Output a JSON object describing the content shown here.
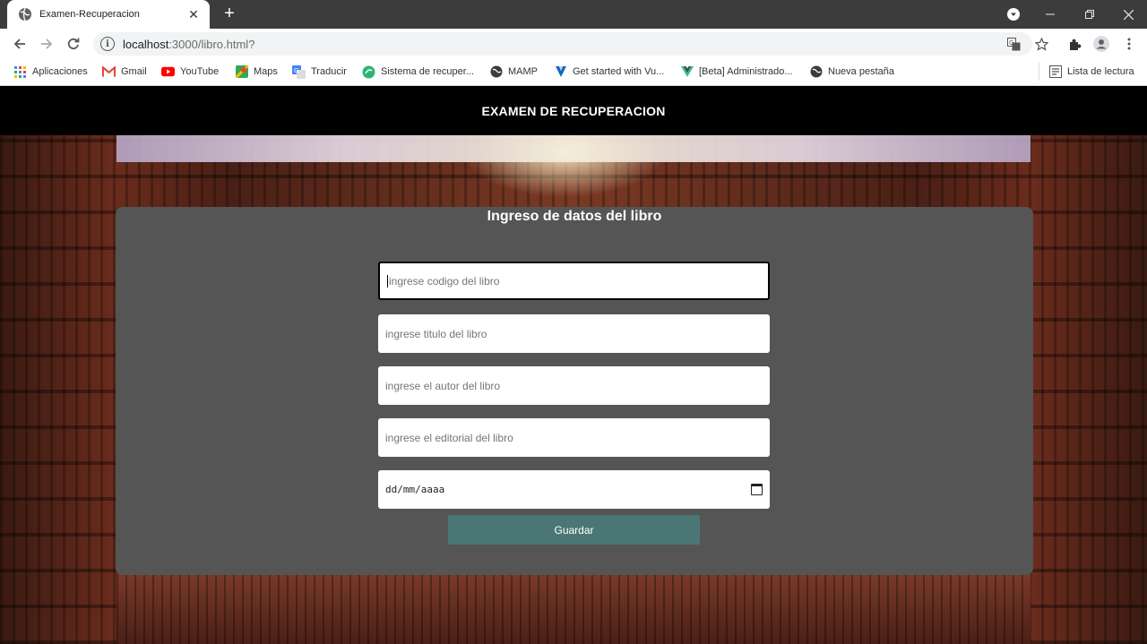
{
  "browser": {
    "tab_title": "Examen-Recuperacion",
    "tab_close": "✕",
    "new_tab": "+",
    "url_host": "localhost",
    "url_path": ":3000/libro.html?",
    "bookmarks": [
      {
        "label": "Aplicaciones",
        "icon": "apps-grid-icon"
      },
      {
        "label": "Gmail",
        "icon": "gmail-icon"
      },
      {
        "label": "YouTube",
        "icon": "youtube-icon"
      },
      {
        "label": "Maps",
        "icon": "maps-icon"
      },
      {
        "label": "Traducir",
        "icon": "translate-icon"
      },
      {
        "label": "Sistema de recuper...",
        "icon": "app-icon"
      },
      {
        "label": "MAMP",
        "icon": "globe-icon"
      },
      {
        "label": "Get started with Vu...",
        "icon": "vuetify-icon"
      },
      {
        "label": "[Beta] Administrado...",
        "icon": "vue-icon"
      },
      {
        "label": "Nueva pestaña",
        "icon": "globe-icon"
      }
    ],
    "reading_list": "Lista de lectura"
  },
  "page": {
    "header_title": "EXAMEN DE RECUPERACION",
    "form_title": "Ingreso de datos del libro",
    "fields": {
      "codigo_placeholder": "ingrese codigo del libro",
      "titulo_placeholder": "ingrese titulo del libro",
      "autor_placeholder": "ingrese el autor del libro",
      "editorial_placeholder": "ingrese el editorial del libro",
      "fecha_placeholder": "dd/mm/aaaa"
    },
    "save_label": "Guardar"
  },
  "colors": {
    "header_bg": "#000000",
    "card_bg": "#555555",
    "button_bg": "#4a7776",
    "tabstrip_bg": "#3c3c3c"
  }
}
